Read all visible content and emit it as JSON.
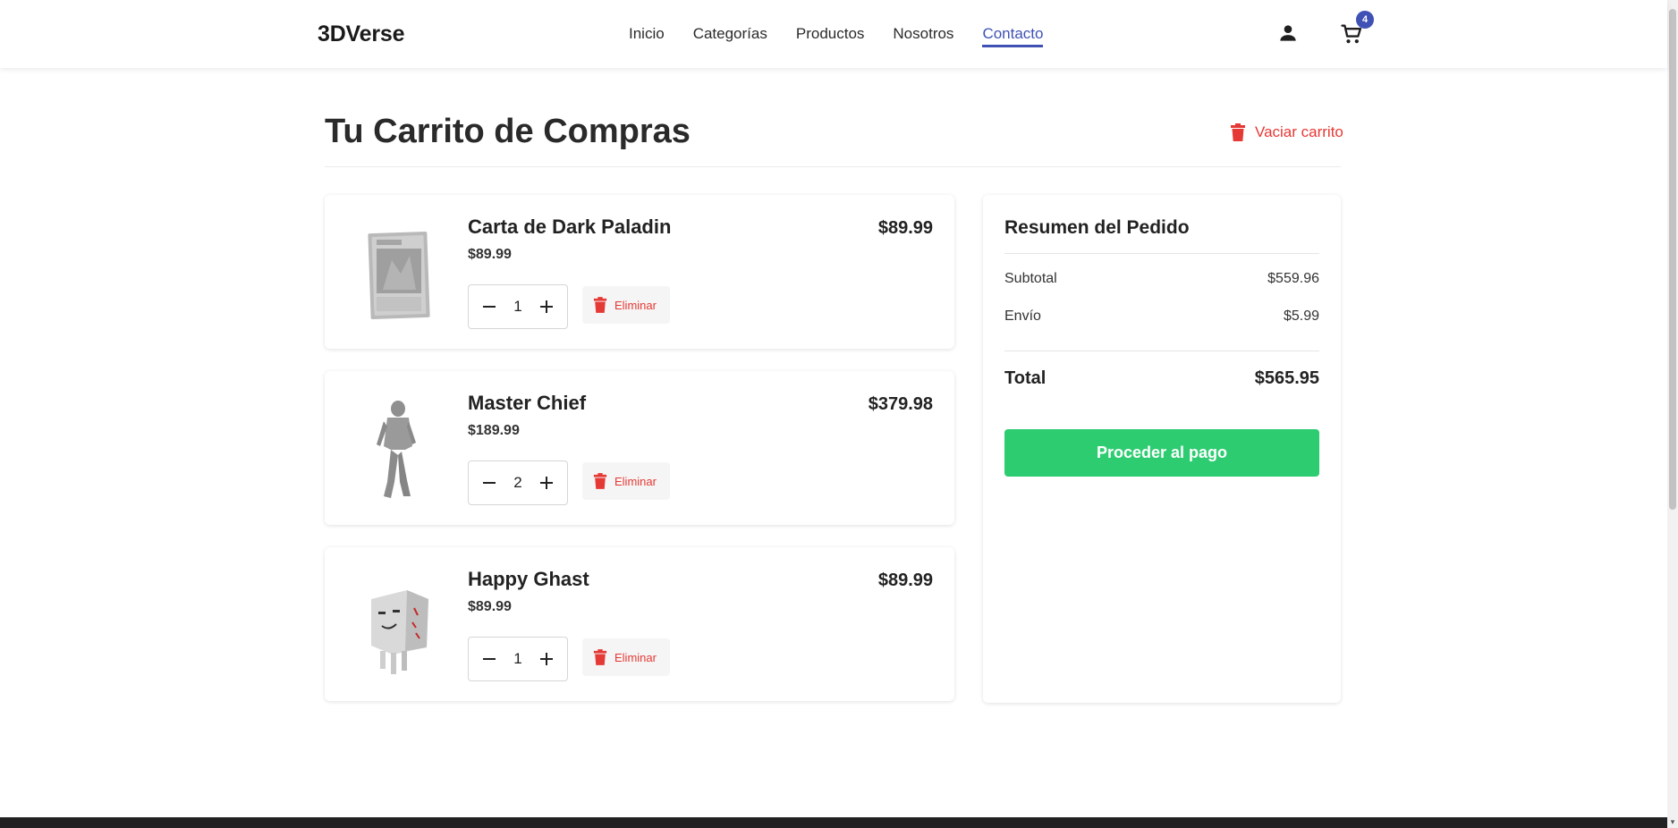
{
  "nav": {
    "brand": "3DVerse",
    "links": [
      "Inicio",
      "Categorías",
      "Productos",
      "Nosotros",
      "Contacto"
    ],
    "active": "Contacto",
    "cart_count": "4"
  },
  "page": {
    "title": "Tu Carrito de Compras",
    "clear_label": "Vaciar carrito"
  },
  "items": [
    {
      "name": "Carta de Dark Paladin",
      "unit_price": "$89.99",
      "quantity": "1",
      "total": "$89.99",
      "remove_label": "Eliminar",
      "icon": "card-image"
    },
    {
      "name": "Master Chief",
      "unit_price": "$189.99",
      "quantity": "2",
      "total": "$379.98",
      "remove_label": "Eliminar",
      "icon": "figure-image"
    },
    {
      "name": "Happy Ghast",
      "unit_price": "$89.99",
      "quantity": "1",
      "total": "$89.99",
      "remove_label": "Eliminar",
      "icon": "ghast-image"
    }
  ],
  "summary": {
    "title": "Resumen del Pedido",
    "subtotal_label": "Subtotal",
    "subtotal_value": "$559.96",
    "shipping_label": "Envío",
    "shipping_value": "$5.99",
    "total_label": "Total",
    "total_value": "$565.95",
    "checkout_label": "Proceder al pago"
  },
  "colors": {
    "accent": "#3f51b5",
    "danger": "#e53935",
    "checkout": "#2ecc71"
  }
}
